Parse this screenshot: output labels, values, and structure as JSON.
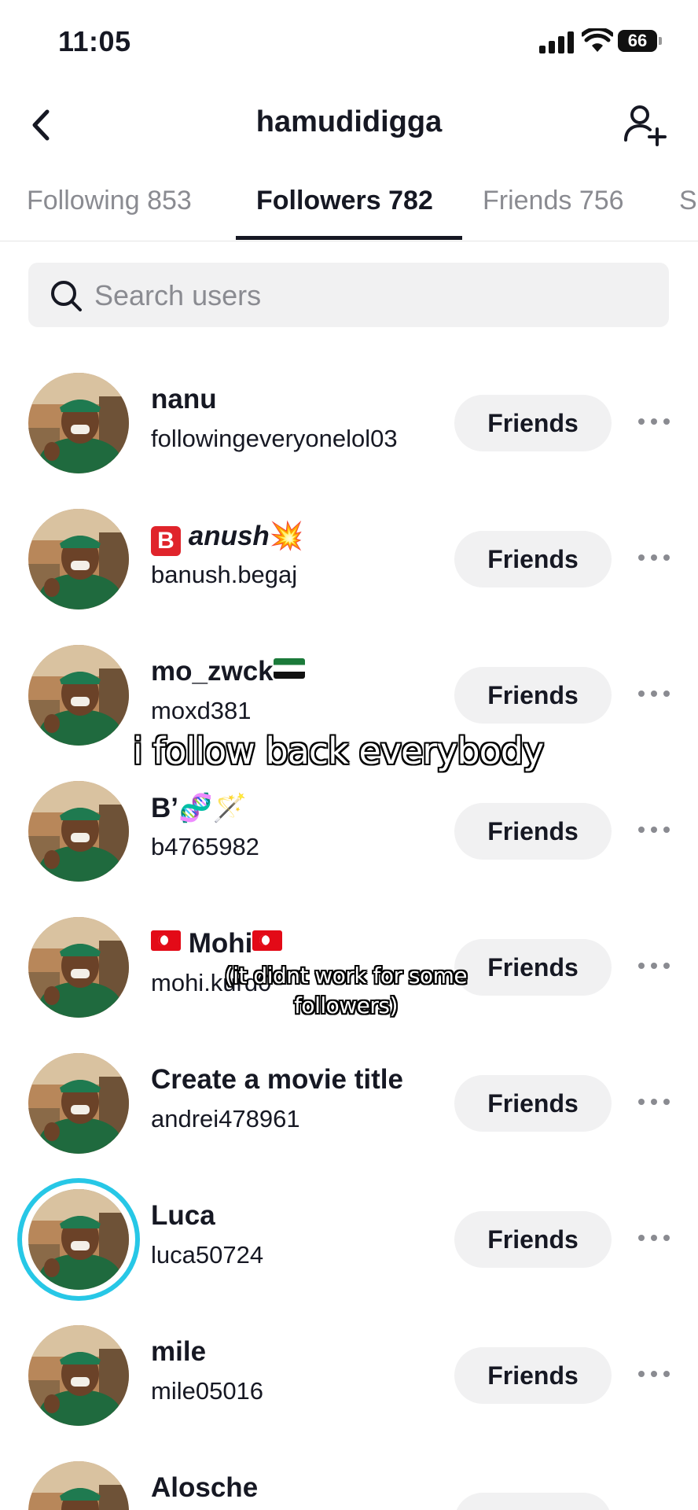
{
  "status_bar": {
    "time": "11:05",
    "battery": "66"
  },
  "header": {
    "title": "hamudidigga"
  },
  "tabs": [
    {
      "label": "Following 853"
    },
    {
      "label": "Followers 782"
    },
    {
      "label": "Friends 756"
    },
    {
      "label": "S"
    }
  ],
  "search": {
    "placeholder": "Search users",
    "value": ""
  },
  "users": [
    {
      "name": "nanu",
      "handle": "followingeveryonelol03",
      "button": "Friends"
    },
    {
      "name_prefix": "B",
      "name": "anush",
      "name_suffix": "💥",
      "handle": "banush.begaj",
      "button": "Friends"
    },
    {
      "name": "mo_zwck",
      "handle": "moxd381",
      "button": "Friends"
    },
    {
      "name": "B’🧬🪄",
      "handle": "b4765982",
      "button": "Friends"
    },
    {
      "name": "Mohi",
      "handle": "mohi.kurd0",
      "button": "Friends"
    },
    {
      "name": "Create a movie title",
      "handle": "andrei478961",
      "button": "Friends"
    },
    {
      "name": "Luca",
      "handle": "luca50724",
      "button": "Friends"
    },
    {
      "name": "mile",
      "handle": "mile05016",
      "button": "Friends"
    },
    {
      "name": "Alosche",
      "handle": "",
      "button": "Friends"
    }
  ],
  "captions": {
    "main": "i follow back everybody",
    "secondary_line1": "(it didnt work for some",
    "secondary_line2": "followers)"
  }
}
